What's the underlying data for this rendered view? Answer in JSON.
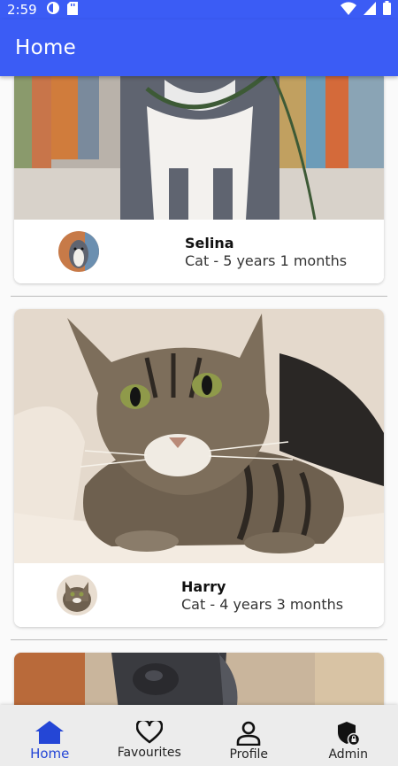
{
  "status_bar": {
    "time": "2:59",
    "icons": [
      "camera-app-icon",
      "sd-card-icon",
      "wifi-icon",
      "signal-icon",
      "battery-icon"
    ]
  },
  "app_bar": {
    "title": "Home"
  },
  "colors": {
    "primary": "#3b5cf5",
    "nav_active": "#2446d6"
  },
  "feed": {
    "items": [
      {
        "name": "Selina",
        "description": "Cat - 5 years 1 months",
        "image": "grey-pitbull-dog-photo"
      },
      {
        "name": "Harry",
        "description": "Cat - 4 years 3 months",
        "image": "tabby-cat-photo"
      },
      {
        "name": "",
        "description": "",
        "image": "grey-dog-photo"
      }
    ]
  },
  "bottom_nav": {
    "items": [
      {
        "label": "Home",
        "icon": "home-icon",
        "active": true
      },
      {
        "label": "Favourites",
        "icon": "heart-icon",
        "active": false
      },
      {
        "label": "Profile",
        "icon": "person-icon",
        "active": false
      },
      {
        "label": "Admin",
        "icon": "shield-lock-icon",
        "active": false
      }
    ]
  }
}
